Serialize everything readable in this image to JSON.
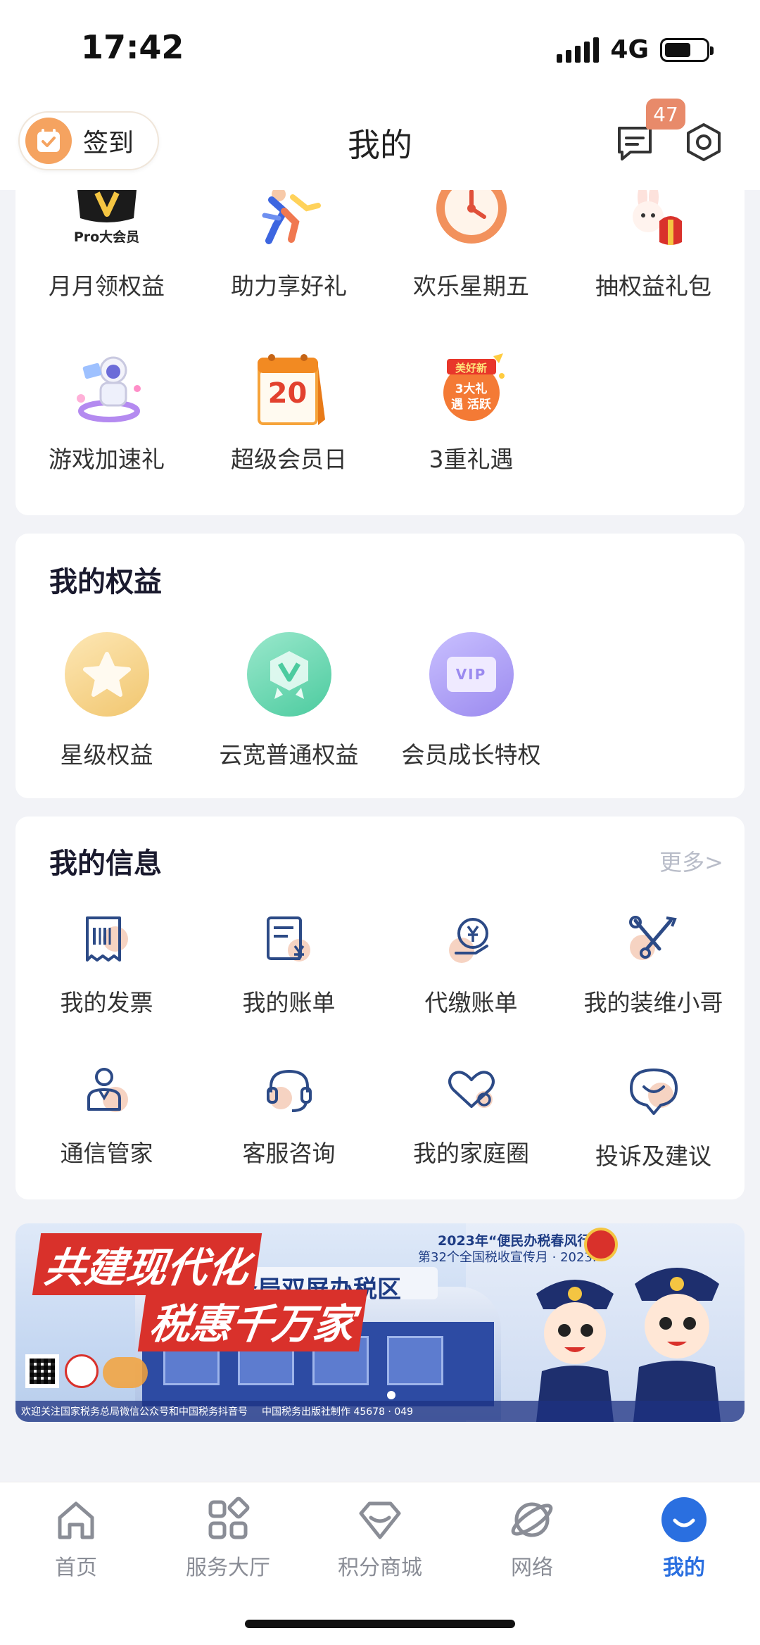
{
  "status_bar": {
    "time": "17:42",
    "network": "4G"
  },
  "header": {
    "checkin_label": "签到",
    "title": "我的",
    "message_badge": "47"
  },
  "top_grid": {
    "row1": [
      {
        "label": "月月领权益",
        "icon": "pro-member-icon",
        "badge_text": "Pro大会员"
      },
      {
        "label": "助力享好礼",
        "icon": "running-people-icon"
      },
      {
        "label": "欢乐星期五",
        "icon": "clock-icon"
      },
      {
        "label": "抽权益礼包",
        "icon": "rabbit-gift-icon"
      }
    ],
    "row2": [
      {
        "label": "游戏加速礼",
        "icon": "astronaut-icon"
      },
      {
        "label": "超级会员日",
        "icon": "calendar-icon",
        "calendar_number": "20"
      },
      {
        "label": "3重礼遇",
        "icon": "gift-badge-icon",
        "badge_text": "3大礼遇 活跃",
        "badge_top": "美好新"
      }
    ]
  },
  "my_benefits": {
    "title": "我的权益",
    "items": [
      {
        "label": "星级权益",
        "icon": "star-icon",
        "color": "#f6cf82"
      },
      {
        "label": "云宽普通权益",
        "icon": "v-badge-icon",
        "color": "#5fd4ac"
      },
      {
        "label": "会员成长特权",
        "icon": "vip-card-icon",
        "color": "#a99af0",
        "icon_text": "VIP"
      }
    ]
  },
  "my_info": {
    "title": "我的信息",
    "more": "更多>",
    "row1": [
      {
        "label": "我的发票",
        "icon": "invoice-icon"
      },
      {
        "label": "我的账单",
        "icon": "bill-icon"
      },
      {
        "label": "代缴账单",
        "icon": "yen-pay-icon"
      },
      {
        "label": "我的装维小哥",
        "icon": "tools-icon"
      }
    ],
    "row2": [
      {
        "label": "通信管家",
        "icon": "butler-icon"
      },
      {
        "label": "客服咨询",
        "icon": "headset-icon"
      },
      {
        "label": "我的家庭圈",
        "icon": "heart-icon"
      },
      {
        "label": "投诉及建议",
        "icon": "smile-bubble-icon"
      }
    ]
  },
  "banner": {
    "headline1": "共建现代化",
    "headline2": "税惠千万家",
    "top_line1": "2023年“便民办税春风行动”",
    "top_line2": "第32个全国税收宣传月 · 2023.4",
    "building_sign": "务局双屏办税区",
    "footer_left": "欢迎关注国家税务总局微信公众号和中国税务抖音号",
    "footer_right": "中国税务出版社制作 45678 · 049"
  },
  "tabbar": [
    {
      "label": "首页",
      "icon": "home-icon"
    },
    {
      "label": "服务大厅",
      "icon": "grid-apps-icon"
    },
    {
      "label": "积分商城",
      "icon": "diamond-icon"
    },
    {
      "label": "网络",
      "icon": "planet-icon"
    },
    {
      "label": "我的",
      "icon": "profile-smile-icon",
      "active": true
    }
  ],
  "colors": {
    "accent": "#2a6fe0",
    "icon_navy": "#2c4a86",
    "icon_peach": "#f6d3c2",
    "badge": "#e88a6a"
  }
}
